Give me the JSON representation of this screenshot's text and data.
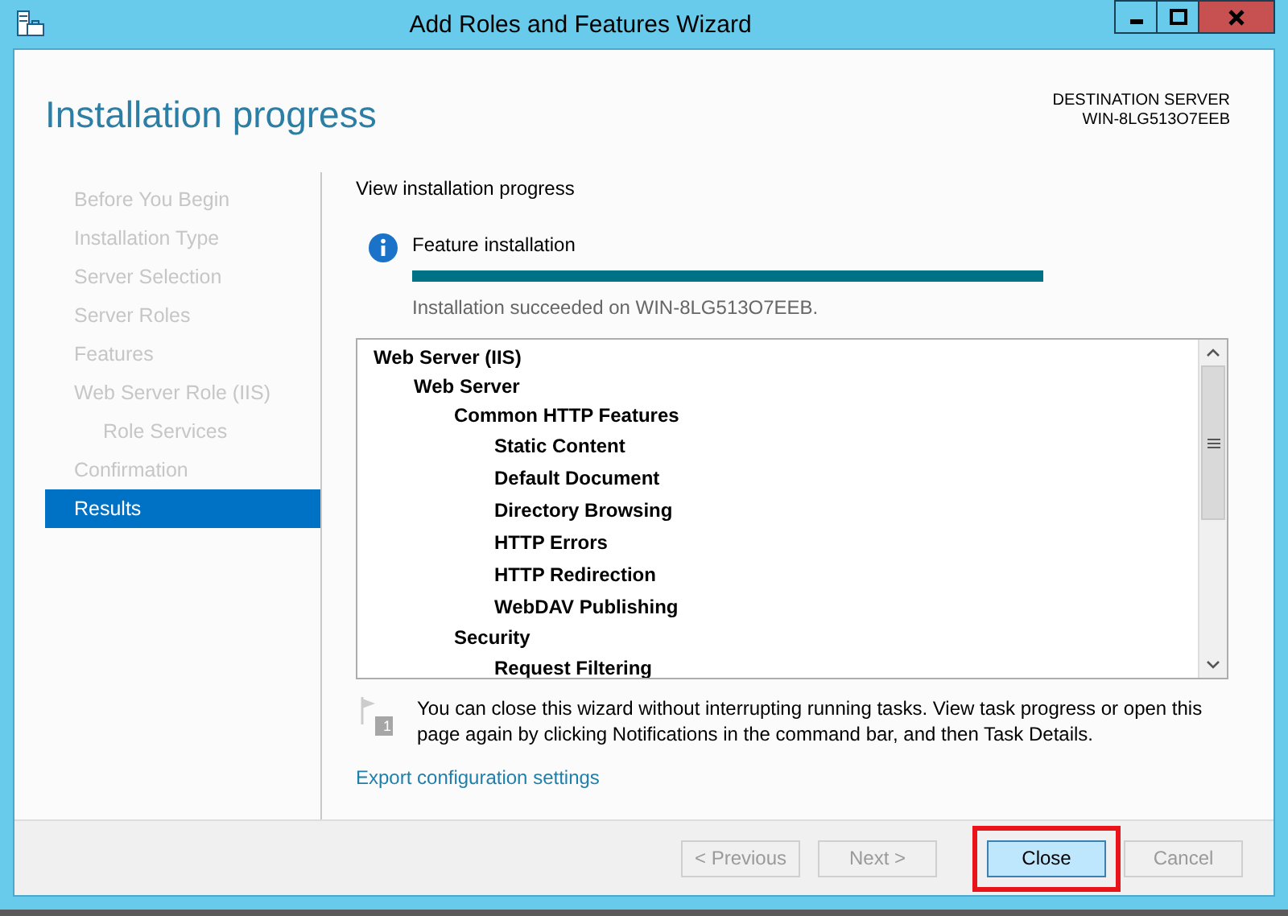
{
  "window": {
    "title": "Add Roles and Features Wizard"
  },
  "header": {
    "title": "Installation progress",
    "destination_label": "DESTINATION SERVER",
    "destination_server": "WIN-8LG513O7EEB"
  },
  "sidebar": {
    "items": [
      {
        "label": "Before You Begin",
        "selected": false
      },
      {
        "label": "Installation Type",
        "selected": false
      },
      {
        "label": "Server Selection",
        "selected": false
      },
      {
        "label": "Server Roles",
        "selected": false
      },
      {
        "label": "Features",
        "selected": false
      },
      {
        "label": "Web Server Role (IIS)",
        "selected": false,
        "children": [
          {
            "label": "Role Services",
            "selected": false
          }
        ]
      },
      {
        "label": "Confirmation",
        "selected": false
      },
      {
        "label": "Results",
        "selected": true
      }
    ]
  },
  "content": {
    "heading": "View installation progress",
    "status": {
      "title": "Feature installation",
      "level": 1,
      "message": "Installation succeeded on WIN-8LG513O7EEB."
    },
    "tree": [
      {
        "label": "Web Server (IIS)",
        "children": [
          {
            "label": "Web Server",
            "children": [
              {
                "label": "Common HTTP Features",
                "children": [
                  {
                    "label": "Static Content"
                  },
                  {
                    "label": "Default Document"
                  },
                  {
                    "label": "Directory Browsing"
                  },
                  {
                    "label": "HTTP Errors"
                  },
                  {
                    "label": "HTTP Redirection"
                  },
                  {
                    "label": "WebDAV Publishing"
                  }
                ]
              },
              {
                "label": "Security",
                "children": [
                  {
                    "label": "Request Filtering"
                  }
                ]
              }
            ]
          }
        ]
      }
    ],
    "notice": {
      "badge": "1",
      "text": "You can close this wizard without interrupting running tasks. View task progress or open this page again by clicking Notifications in the command bar, and then Task Details."
    },
    "export_link": "Export configuration settings"
  },
  "buttons": [
    {
      "label": "< Previous",
      "disabled": true,
      "default": false,
      "highlighted": false
    },
    {
      "label": "Next >",
      "disabled": true,
      "default": false,
      "highlighted": false
    },
    {
      "label": "Close",
      "disabled": false,
      "default": true,
      "highlighted": true
    },
    {
      "label": "Cancel",
      "disabled": true,
      "default": false,
      "highlighted": false
    }
  ]
}
